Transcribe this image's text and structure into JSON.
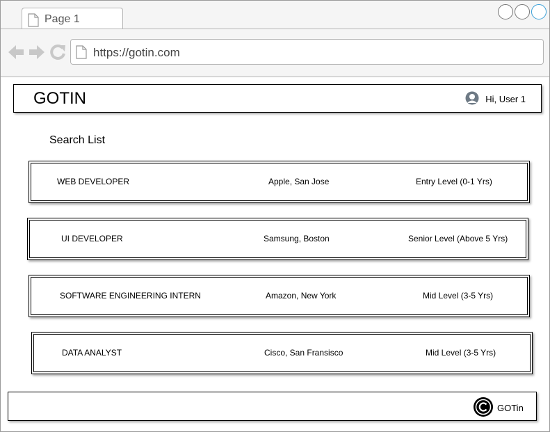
{
  "browser": {
    "tab_label": "Page 1",
    "url": "https://gotin.com",
    "icons": [
      "back-arrow-icon",
      "forward-arrow-icon",
      "reload-icon",
      "page-icon"
    ]
  },
  "header": {
    "brand": "GOTIN",
    "greeting": "Hi, User 1",
    "avatar_icon": "user-avatar-icon"
  },
  "main": {
    "section_title": "Search List",
    "jobs": [
      {
        "title": "WEB DEVELOPER",
        "company": "Apple, San Jose",
        "level": "Entry Level (0-1 Yrs)"
      },
      {
        "title": "UI DEVELOPER",
        "company": "Samsung, Boston",
        "level": "Senior Level (Above 5 Yrs)"
      },
      {
        "title": "SOFTWARE ENGINEERING INTERN",
        "company": "Amazon, New York",
        "level": "Mid Level (3-5 Yrs)"
      },
      {
        "title": "DATA ANALYST",
        "company": "Cisco, San Fransisco",
        "level": "Mid Level (3-5 Yrs)"
      }
    ]
  },
  "footer": {
    "copyright_text": "GOTin",
    "icon": "copyright-icon"
  }
}
